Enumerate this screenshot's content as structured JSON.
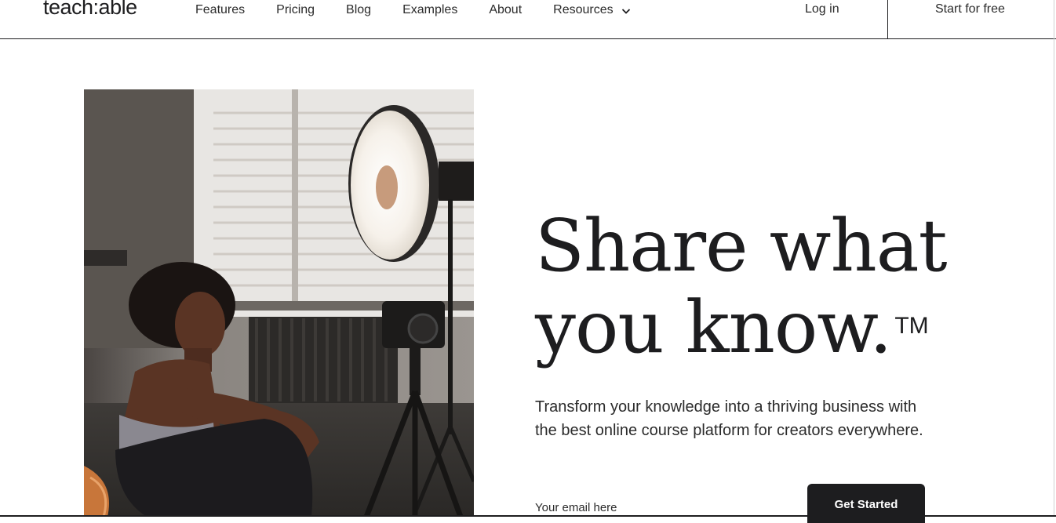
{
  "header": {
    "logo": "teach:able",
    "nav": [
      {
        "label": "Features"
      },
      {
        "label": "Pricing"
      },
      {
        "label": "Blog"
      },
      {
        "label": "Examples"
      },
      {
        "label": "About"
      },
      {
        "label": "Resources"
      }
    ],
    "login_label": "Log in",
    "start_free_label": "Start for free"
  },
  "hero": {
    "headline_line1": "Share what",
    "headline_line2": "you know.",
    "trademark": "TM",
    "subtext": "Transform your knowledge into a thriving business with the best online course platform for creators everywhere.",
    "email_placeholder": "Your email here",
    "cta_label": "Get Started",
    "image_icon": "photo-creator-with-camera-and-light"
  },
  "colors": {
    "text_primary": "#1d1d1f",
    "button_bg": "#1d1d1f",
    "button_text": "#ffffff",
    "background": "#ffffff"
  }
}
